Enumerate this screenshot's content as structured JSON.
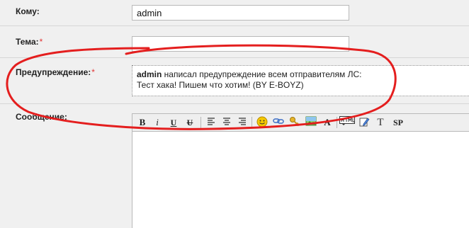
{
  "form": {
    "to_label": "Кому:",
    "to_value": "admin",
    "subject_label": "Тема:",
    "subject_value": "",
    "required_mark": "*",
    "warning_label": "Предупреждение:",
    "warning_author": "admin",
    "warning_line1_rest": " написал предупреждение всем отправителям ЛС:",
    "warning_line2": "Тест хака! Пишем что хотим! (BY E-BOYZ)",
    "message_label": "Сообщение:"
  },
  "toolbar": {
    "bold": "B",
    "italic": "i",
    "underline": "U",
    "strike": "U",
    "text_tool": "T",
    "spoiler": "SP",
    "color_letter": "A"
  },
  "icons": [
    "bold-icon",
    "italic-icon",
    "underline-icon",
    "strike-icon",
    "align-left-icon",
    "align-center-icon",
    "align-right-icon",
    "smiley-icon",
    "link-icon",
    "key-icon",
    "image-icon",
    "font-color-icon",
    "html-icon",
    "edit-icon",
    "text-icon",
    "spoiler-icon"
  ],
  "colors": {
    "annotation": "#e41e1e",
    "required": "#e23636",
    "row_bg": "#f0f0f0"
  }
}
